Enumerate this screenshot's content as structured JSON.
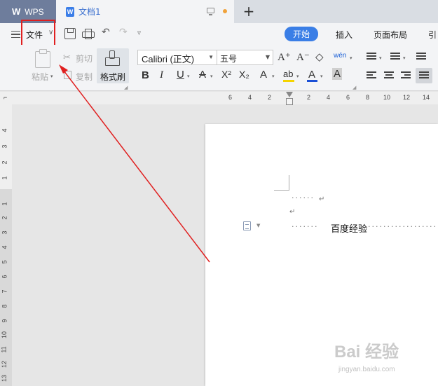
{
  "titlebar": {
    "app_tab": {
      "logo": "W",
      "label": "WPS"
    },
    "doc_tab": {
      "icon": "W",
      "name": "文档1",
      "status_dot_color": "#f0a23a"
    },
    "new_tab": "+"
  },
  "menubar": {
    "file_label": "文件",
    "file_caret": "∨",
    "undo": "↶",
    "redo": "↷",
    "more": "▿",
    "tabs": [
      "开始",
      "插入",
      "页面布局",
      "引"
    ],
    "active_tab_color": "#3a7ee6"
  },
  "ribbon": {
    "paste_label": "粘贴",
    "cut_label": "剪切",
    "copy_label": "复制",
    "format_painter_label": "格式刷",
    "font_name": "Calibri (正文)",
    "font_size": "五号",
    "grow_font": "A⁺",
    "shrink_font": "A⁻",
    "clear_format": "◇",
    "phonetic": "wén",
    "bold": "B",
    "italic": "I",
    "underline": "U",
    "strikethrough": "A",
    "superscript": "X²",
    "subscript": "X₂",
    "text_effect": "A",
    "highlight": "ab",
    "font_color": "A",
    "char_shading": "A",
    "highlight_color": "#f5d400",
    "font_color_value": "#1a4fd6"
  },
  "ruler": {
    "horizontal": [
      "6",
      "4",
      "2",
      "2",
      "4",
      "6",
      "8",
      "10",
      "12",
      "14"
    ],
    "vertical": [
      "4",
      "3",
      "2",
      "1",
      "1",
      "2",
      "3",
      "4",
      "5",
      "6",
      "7",
      "8",
      "9",
      "10",
      "11",
      "12",
      "13"
    ]
  },
  "document": {
    "dots1": "······",
    "para_mark": "↵",
    "dots2": "·······",
    "text": "百度经验",
    "dots3": "·······················"
  },
  "watermark": {
    "main": "Bai 经验",
    "sub": "jingyan.baidu.com"
  },
  "annotation": {
    "box_color": "#e02020",
    "arrow_color": "#e02020"
  }
}
